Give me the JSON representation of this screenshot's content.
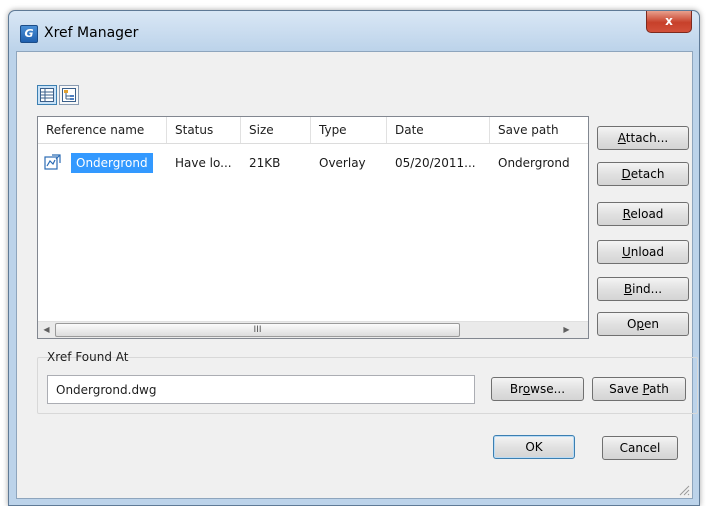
{
  "window": {
    "title": "Xref Manager",
    "app_icon_letter": "G",
    "close_glyph": "x"
  },
  "view_toggle": {
    "list_view_icon": "list-view-icon",
    "tree_view_icon": "tree-view-icon"
  },
  "table": {
    "columns": [
      "Reference name",
      "Status",
      "Size",
      "Type",
      "Date",
      "Save path"
    ],
    "rows": [
      {
        "name": "Ondergrond",
        "status": "Have lo...",
        "size": "21KB",
        "type": "Overlay",
        "date": "05/20/2011...",
        "save_path": "Ondergrond"
      }
    ],
    "scroll": {
      "left": "◀",
      "right": "▶",
      "thumb_grip": "III"
    }
  },
  "buttons": {
    "attach": {
      "pre": "",
      "accel": "A",
      "post": "ttach..."
    },
    "detach": {
      "pre": "",
      "accel": "D",
      "post": "etach"
    },
    "reload": {
      "pre": "",
      "accel": "R",
      "post": "eload"
    },
    "unload": {
      "pre": "",
      "accel": "U",
      "post": "nload"
    },
    "bind": {
      "pre": "",
      "accel": "B",
      "post": "ind..."
    },
    "open": {
      "pre": "O",
      "accel": "p",
      "post": "en"
    },
    "browse": {
      "pre": "Br",
      "accel": "o",
      "post": "wse..."
    },
    "save_path": {
      "pre": "Save ",
      "accel": "P",
      "post": "ath"
    },
    "ok": "OK",
    "cancel": "Cancel"
  },
  "found_at": {
    "label": "Xref Found At",
    "value": "Ondergrond.dwg"
  },
  "colors": {
    "selection": "#3399ff",
    "close": "#c7402a",
    "frame": "#bcd3ea"
  }
}
